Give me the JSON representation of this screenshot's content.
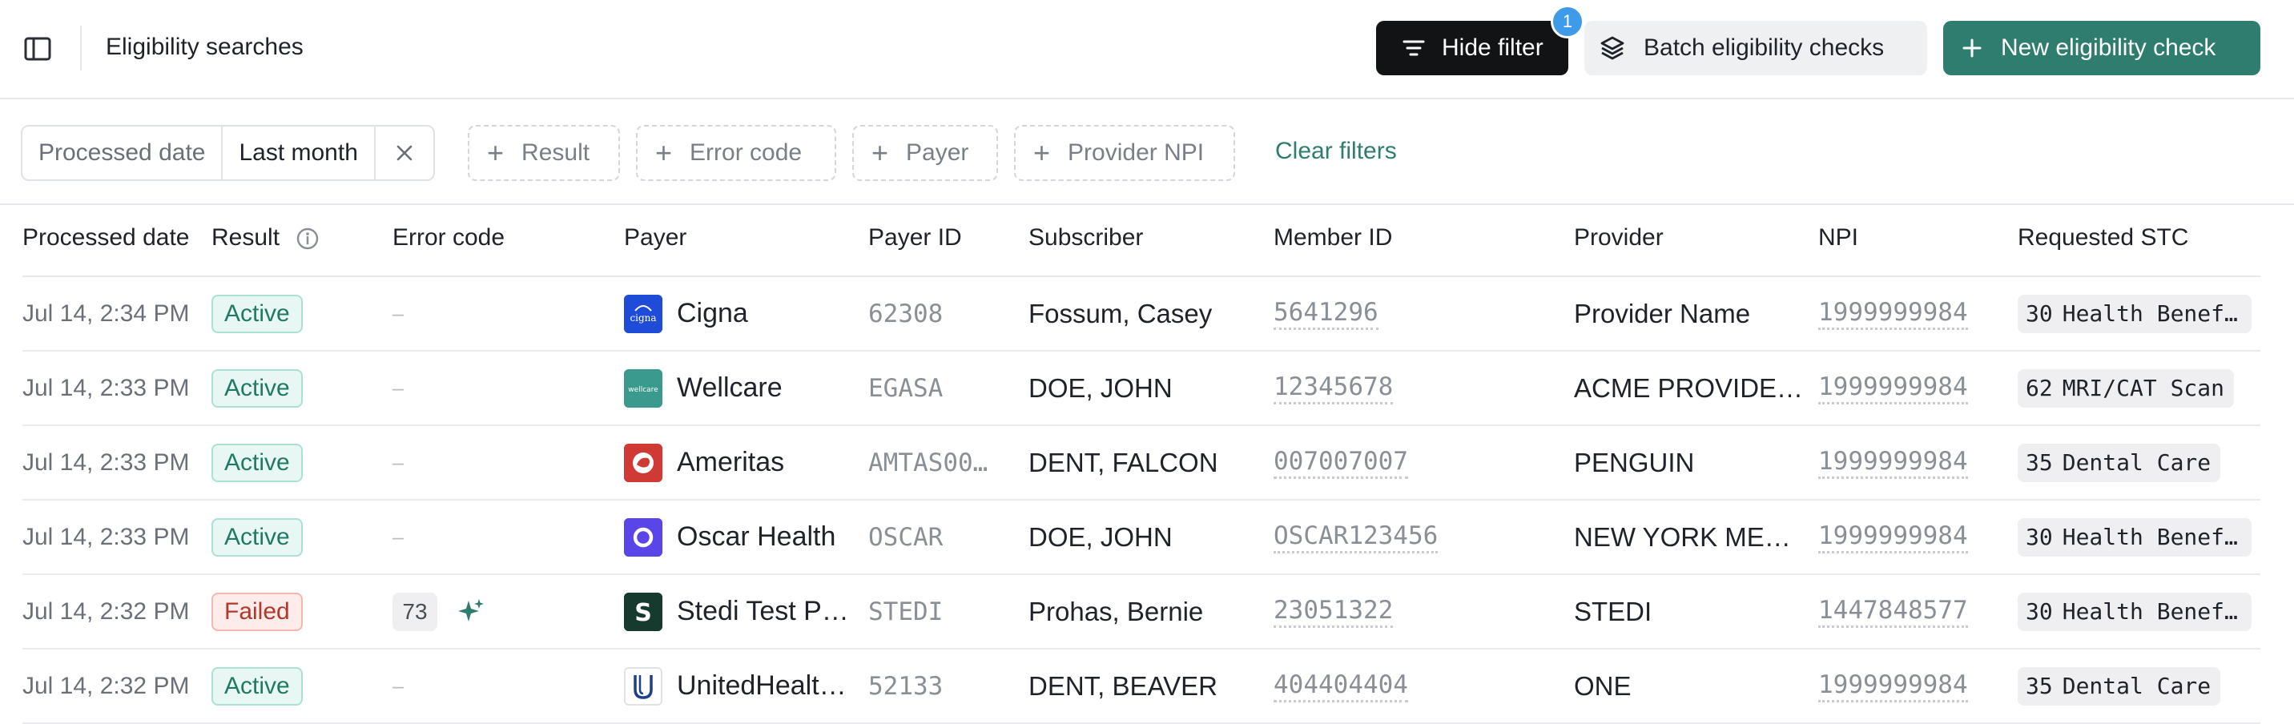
{
  "header": {
    "title": "Eligibility searches",
    "hide_filter_label": "Hide filter",
    "filter_count": "1",
    "batch_label": "Batch eligibility checks",
    "new_check_label": "New eligibility check"
  },
  "filters": {
    "active": {
      "field": "Processed date",
      "value": "Last month"
    },
    "add_result": "Result",
    "add_error_code": "Error code",
    "add_payer": "Payer",
    "add_provider_npi": "Provider NPI",
    "clear_label": "Clear filters"
  },
  "table": {
    "columns": [
      "Processed date",
      "Result",
      "Error code",
      "Payer",
      "Payer ID",
      "Subscriber",
      "Member ID",
      "Provider",
      "NPI",
      "Requested STC"
    ],
    "rows": [
      {
        "date": "Jul 14, 2:34 PM",
        "result": "Active",
        "error_code": "–",
        "payer": "Cigna",
        "payer_logo": "cigna-logo",
        "payer_id": "62308",
        "subscriber": "Fossum, Casey",
        "member_id": "5641296",
        "provider": "Provider Name",
        "npi": "1999999984",
        "stc_code": "30",
        "stc_desc": "Health Benefit Plan Coverage"
      },
      {
        "date": "Jul 14, 2:33 PM",
        "result": "Active",
        "error_code": "–",
        "payer": "Wellcare",
        "payer_logo": "wellcare-logo",
        "payer_id": "EGASA",
        "subscriber": "DOE, JOHN",
        "member_id": "12345678",
        "provider": "ACME PROVIDE…",
        "npi": "1999999984",
        "stc_code": "62",
        "stc_desc": "MRI/CAT Scan"
      },
      {
        "date": "Jul 14, 2:33 PM",
        "result": "Active",
        "error_code": "–",
        "payer": "Ameritas",
        "payer_logo": "ameritas-logo",
        "payer_id": "AMTAS00…",
        "subscriber": "DENT, FALCON",
        "member_id": "007007007",
        "provider": "PENGUIN",
        "npi": "1999999984",
        "stc_code": "35",
        "stc_desc": "Dental Care"
      },
      {
        "date": "Jul 14, 2:33 PM",
        "result": "Active",
        "error_code": "–",
        "payer": "Oscar Health",
        "payer_logo": "oscar-logo",
        "payer_id": "OSCAR",
        "subscriber": "DOE, JOHN",
        "member_id": "OSCAR123456",
        "provider": "NEW YORK ME…",
        "npi": "1999999984",
        "stc_code": "30",
        "stc_desc": "Health Benefit Plan Coverage"
      },
      {
        "date": "Jul 14, 2:32 PM",
        "result": "Failed",
        "error_code": "73",
        "payer": "Stedi Test P…",
        "payer_logo": "stedi-logo",
        "payer_id": "STEDI",
        "subscriber": "Prohas, Bernie",
        "member_id": "23051322",
        "provider": "STEDI",
        "npi": "1447848577",
        "stc_code": "30",
        "stc_desc": "Health Benefit Plan Coverage"
      },
      {
        "date": "Jul 14, 2:32 PM",
        "result": "Active",
        "error_code": "–",
        "payer": "UnitedHealt…",
        "payer_logo": "uhc-logo",
        "payer_id": "52133",
        "subscriber": "DENT, BEAVER",
        "member_id": "404404404",
        "provider": "ONE",
        "npi": "1999999984",
        "stc_code": "35",
        "stc_desc": "Dental Care"
      }
    ]
  },
  "colors": {
    "brand_green": "#2f7d6f",
    "active_bg": "#e8f7f3",
    "failed_bg": "#fdecea",
    "badge_blue": "#3d9be9"
  }
}
